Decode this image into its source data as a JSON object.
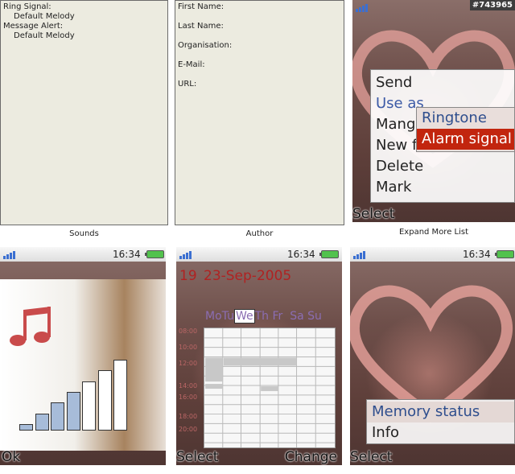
{
  "panels": {
    "sounds": {
      "ring_signal_label": "Ring Signal:",
      "ring_signal_value": "Default Melody",
      "message_alert_label": "Message Alert:",
      "message_alert_value": "Default Melody",
      "caption": "Sounds"
    },
    "author": {
      "first_name_label": "First Name:",
      "last_name_label": "Last Name:",
      "organisation_label": "Organisation:",
      "email_label": "E-Mail:",
      "url_label": "URL:",
      "caption": "Author"
    },
    "expand_caption": "Expand More List"
  },
  "watermark": "#743965",
  "screens": {
    "menu_screen": {
      "menu_items": [
        "Send",
        "Use as",
        "Mange",
        "New f",
        "Delete",
        "Mark"
      ],
      "selected_index": 1,
      "submenu_items": [
        "Ringtone",
        "Alarm signal"
      ],
      "submenu_highlight_index": 1,
      "left_softkey": "Select"
    },
    "sounds_screen": {
      "clock": "16:34",
      "left_softkey": "Ok",
      "volume_levels": 7,
      "icon": "music-notes-icon"
    },
    "calendar_screen": {
      "clock": "16:34",
      "week": "19",
      "date": "23-Sep-2005",
      "days": [
        "Mo",
        "Tu",
        "We",
        "Th",
        "Fr",
        "Sa",
        "Su"
      ],
      "selected_day": "We",
      "hours": [
        "08:00",
        "10:00",
        "12:00",
        "14:00",
        "16:00",
        "18:00",
        "20:00"
      ],
      "left_softkey": "Select",
      "right_softkey": "Change"
    },
    "memory_screen": {
      "clock": "16:34",
      "menu_items": [
        "Memory status",
        "Info"
      ],
      "selected_index": 0,
      "left_softkey": "Select"
    }
  },
  "colors": {
    "panel_bg": "#ecebe0",
    "accent_red": "#c2250e",
    "selection_blue": "#3c5aa6",
    "battery_green": "#52c24d"
  }
}
